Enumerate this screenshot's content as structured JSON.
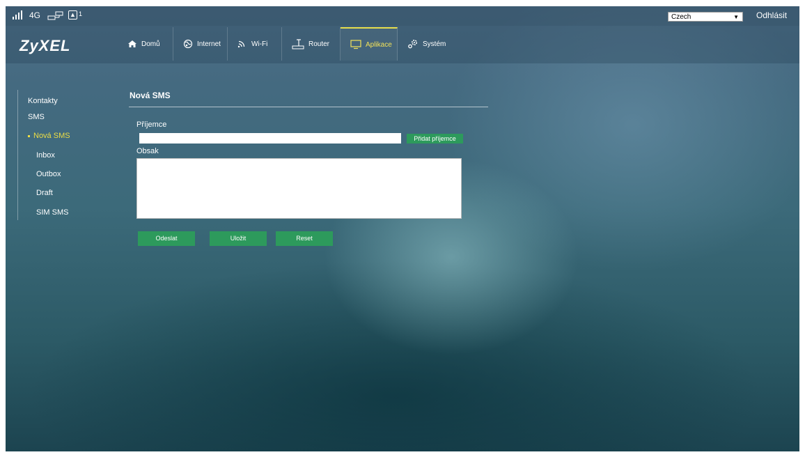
{
  "status_bar": {
    "signal_icon": "signal-bars-icon",
    "network_type": "4G",
    "lan_icon": "lan-ports-icon",
    "user_icon": "user-icon",
    "connected_users": "1",
    "language": "Czech",
    "logout": "Odhlásit"
  },
  "header": {
    "logo": "ZyXEL",
    "tabs": [
      {
        "label": "Domů",
        "icon": "home-icon"
      },
      {
        "label": "Internet",
        "icon": "globe-icon"
      },
      {
        "label": "Wi-Fi",
        "icon": "wifi-icon"
      },
      {
        "label": "Router",
        "icon": "router-icon"
      },
      {
        "label": "Aplikace",
        "icon": "monitor-icon",
        "active": true
      },
      {
        "label": "Systém",
        "icon": "gears-icon"
      }
    ]
  },
  "sidebar": {
    "items": [
      {
        "label": "Kontakty"
      },
      {
        "label": "SMS"
      },
      {
        "label": "Nová SMS",
        "active": true
      },
      {
        "label": "Inbox"
      },
      {
        "label": "Outbox"
      },
      {
        "label": "Draft"
      },
      {
        "label": "SIM SMS"
      }
    ]
  },
  "main": {
    "title": "Nová SMS",
    "recipient_label": "Příjemce",
    "recipient_value": "",
    "add_recipient_button": "Přidat příjemce",
    "content_label": "Obsak",
    "content_value": "",
    "buttons": {
      "send": "Odeslat",
      "save": "Uložit",
      "reset": "Reset"
    }
  },
  "colors": {
    "accent_yellow": "#ecdd45",
    "button_green": "#2d9a5c"
  }
}
